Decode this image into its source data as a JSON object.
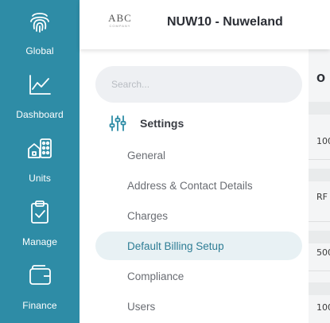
{
  "rail": {
    "items": [
      {
        "label": "Global",
        "icon": "fingerprint-icon"
      },
      {
        "label": "Dashboard",
        "icon": "line-chart-icon"
      },
      {
        "label": "Units",
        "icon": "buildings-icon"
      },
      {
        "label": "Manage",
        "icon": "clipboard-check-icon"
      },
      {
        "label": "Finance",
        "icon": "wallet-icon"
      }
    ],
    "background": "#2e8ca6"
  },
  "header": {
    "logo_text": "ABC",
    "logo_sub": "COMPANY",
    "company_name": "NUW10 - Nuweland"
  },
  "search": {
    "placeholder": "Search..."
  },
  "settings": {
    "title": "Settings",
    "icon": "sliders-icon",
    "items": [
      {
        "label": "General",
        "active": false
      },
      {
        "label": "Address & Contact Details",
        "active": false
      },
      {
        "label": "Charges",
        "active": false
      },
      {
        "label": "Default Billing Setup",
        "active": true
      },
      {
        "label": "Compliance",
        "active": false
      },
      {
        "label": "Users",
        "active": false
      }
    ]
  },
  "background_peek": {
    "column_header": "O",
    "cells": [
      "100",
      "RF",
      "500",
      "100"
    ]
  },
  "colors": {
    "accent": "#2e8ca6",
    "active_bg": "#e8f1f4",
    "active_text": "#2e7d95"
  }
}
